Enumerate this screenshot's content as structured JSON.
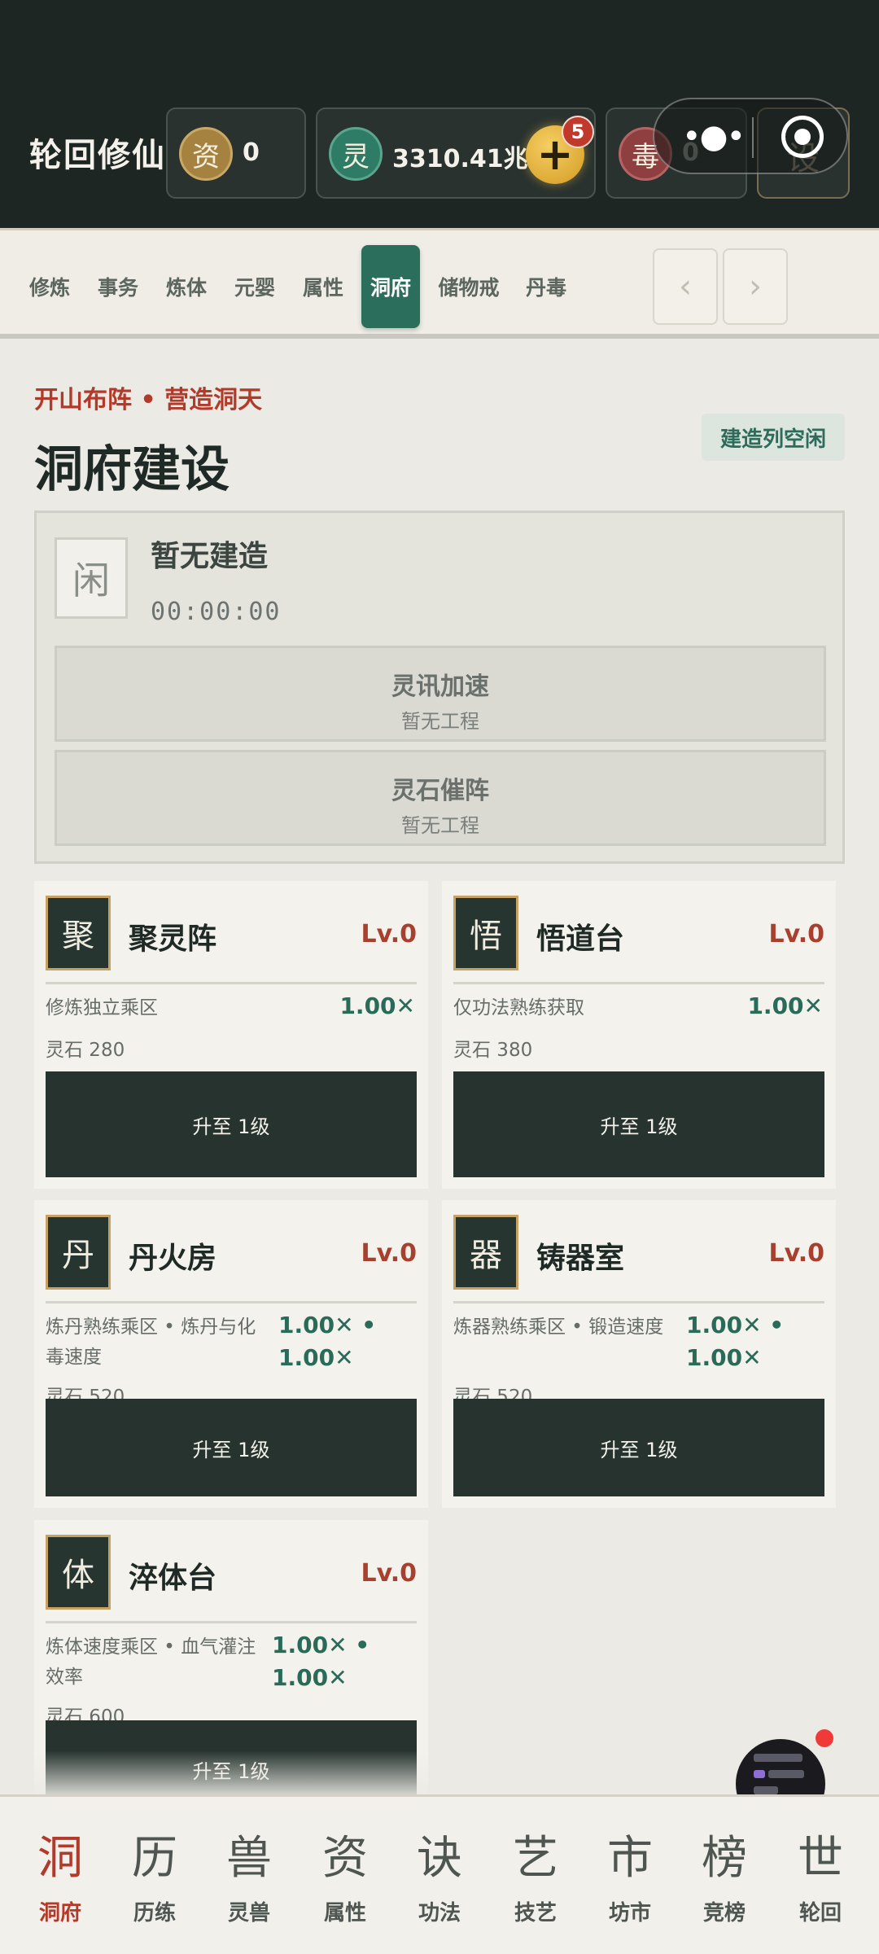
{
  "header": {
    "title": "轮回修仙",
    "resources": [
      {
        "icon": "资",
        "value": "0",
        "color": "#a5823f"
      },
      {
        "icon": "灵",
        "value": "3310.41兆",
        "color": "#2f7c66"
      },
      {
        "icon": "毒",
        "value": "0",
        "color": "#8f3f3f"
      }
    ],
    "plus_badge": "5",
    "settings_glyph": "设"
  },
  "tabs": {
    "items": [
      "修炼",
      "事务",
      "炼体",
      "元婴",
      "属性",
      "洞府",
      "储物戒",
      "丹毒"
    ],
    "active": "洞府",
    "prev": "‹",
    "next": "›"
  },
  "main": {
    "breadcrumb": "开山布阵 • 营造洞天",
    "title": "洞府建设",
    "queue_status": "建造列空闲",
    "build": {
      "idle_glyph": "闲",
      "status": "暂无建造",
      "timer": "00:00:00",
      "speedups": [
        {
          "title": "灵讯加速",
          "sub": "暂无工程"
        },
        {
          "title": "灵石催阵",
          "sub": "暂无工程"
        }
      ]
    },
    "cards": [
      {
        "glyph": "聚",
        "name": "聚灵阵",
        "level": "Lv.0",
        "desc": "修炼独立乘区",
        "mult": "1.00✕",
        "cost": "灵石 280",
        "button": "升至 1级"
      },
      {
        "glyph": "悟",
        "name": "悟道台",
        "level": "Lv.0",
        "desc": "仅功法熟练获取",
        "mult": "1.00✕",
        "cost": "灵石 380",
        "button": "升至 1级"
      },
      {
        "glyph": "丹",
        "name": "丹火房",
        "level": "Lv.0",
        "desc": "炼丹熟练乘区 • 炼丹与化毒速度",
        "mult": "1.00✕ •\n1.00✕",
        "cost": "灵石 520",
        "button": "升至 1级"
      },
      {
        "glyph": "器",
        "name": "铸器室",
        "level": "Lv.0",
        "desc": "炼器熟练乘区 • 锻造速度",
        "mult": "1.00✕ •\n1.00✕",
        "cost": "灵石 520",
        "button": "升至 1级"
      },
      {
        "glyph": "体",
        "name": "淬体台",
        "level": "Lv.0",
        "desc": "炼体速度乘区 • 血气灌注效率",
        "mult": "1.00✕ •\n1.00✕",
        "cost": "灵石 600",
        "button": "升至 1级"
      }
    ]
  },
  "bottom_nav": {
    "items": [
      {
        "glyph": "洞",
        "label": "洞府"
      },
      {
        "glyph": "历",
        "label": "历练"
      },
      {
        "glyph": "兽",
        "label": "灵兽"
      },
      {
        "glyph": "资",
        "label": "属性"
      },
      {
        "glyph": "诀",
        "label": "功法"
      },
      {
        "glyph": "艺",
        "label": "技艺"
      },
      {
        "glyph": "市",
        "label": "坊市"
      },
      {
        "glyph": "榜",
        "label": "竞榜"
      },
      {
        "glyph": "世",
        "label": "轮回"
      }
    ],
    "active": "洞府"
  },
  "colors": {
    "accent": "#2c6e5c",
    "danger": "#b23a2a",
    "dark": "#1e2623"
  }
}
